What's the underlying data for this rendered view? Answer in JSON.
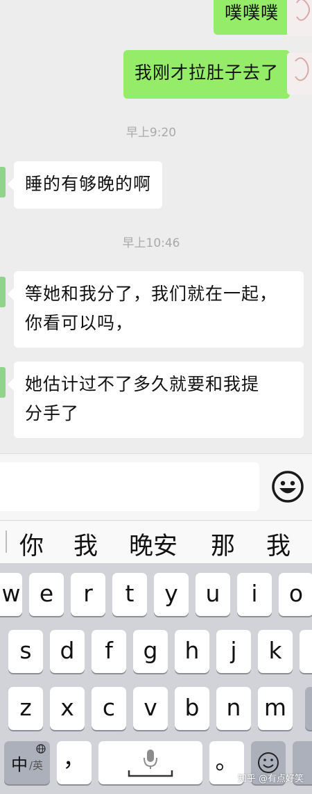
{
  "chat": {
    "messages": [
      {
        "side": "out",
        "text": "噗噗噗"
      },
      {
        "side": "out",
        "text": "我刚才拉肚子去了"
      },
      {
        "side": "time",
        "text": "早上9:20"
      },
      {
        "side": "in",
        "text": "睡的有够晚的啊"
      },
      {
        "side": "time",
        "text": "早上10:46"
      },
      {
        "side": "in",
        "lines": [
          "等她和我分了，我们就在一起，",
          "你看可以吗，"
        ]
      },
      {
        "side": "in",
        "lines": [
          "她估计过不了多久就要和我提",
          "分手了"
        ]
      }
    ]
  },
  "input": {
    "value": ""
  },
  "candidates": [
    "你",
    "我",
    "晚安",
    "那",
    "我"
  ],
  "keyboard": {
    "row1": [
      "w",
      "e",
      "r",
      "t",
      "y",
      "u",
      "i",
      "o"
    ],
    "row2": [
      "s",
      "d",
      "f",
      "g",
      "h",
      "j",
      "k"
    ],
    "row3": [
      "z",
      "x",
      "c",
      "v",
      "b",
      "n",
      "m"
    ],
    "bottom": {
      "lang_main": "中",
      "lang_alt": "/英",
      "comma": "，",
      "period": "。"
    }
  },
  "watermark": "知乎 @有点好笑",
  "icons": {
    "emoji": "smiley-face-icon",
    "globe": "globe-icon",
    "mic": "microphone-icon"
  }
}
